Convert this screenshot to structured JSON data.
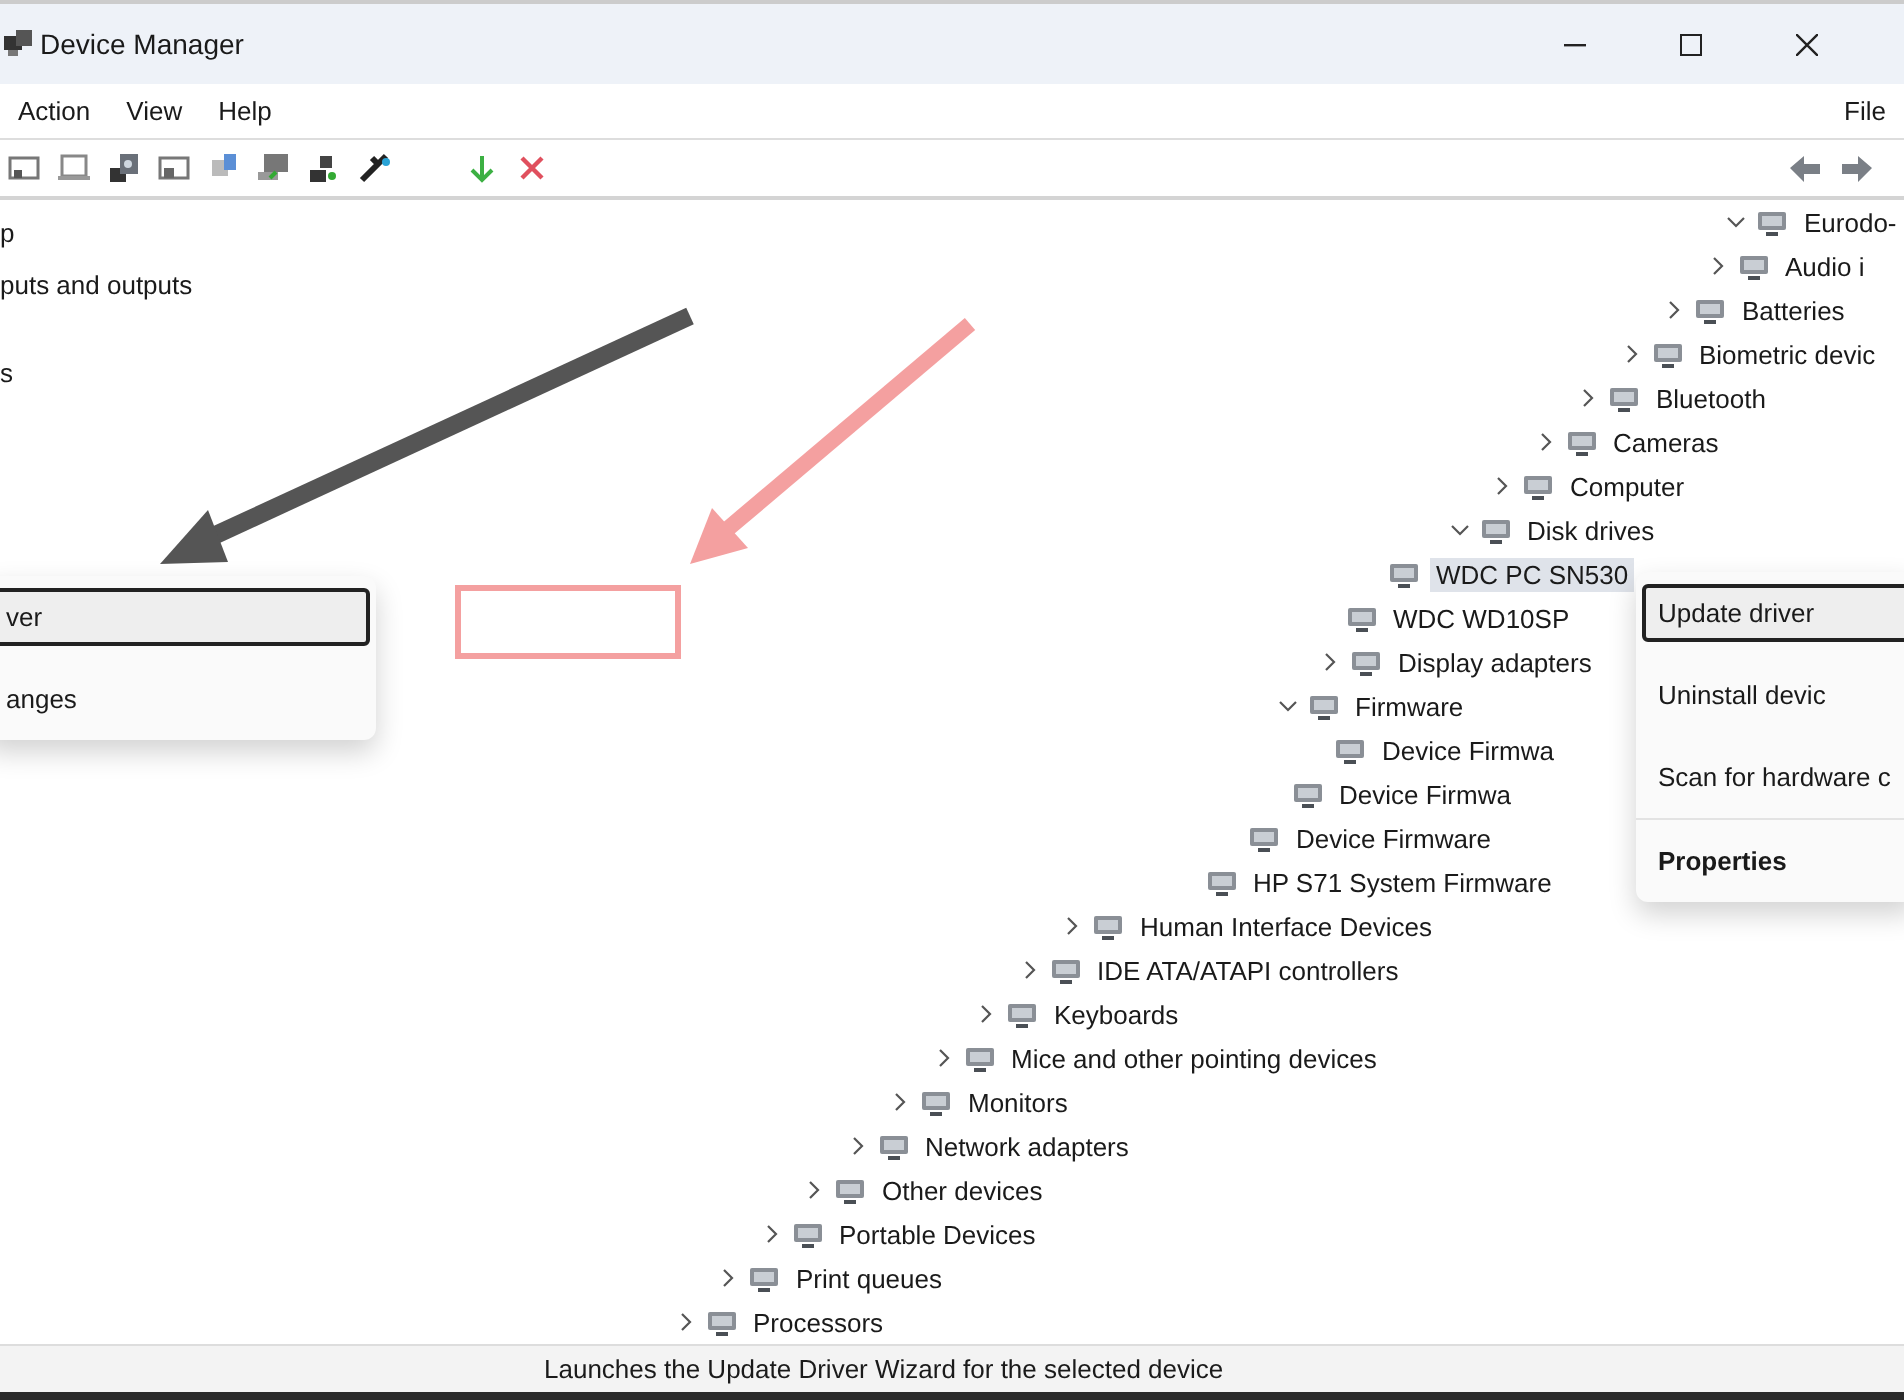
{
  "window": {
    "title": "Device Manager"
  },
  "menu": [
    {
      "label": "Action"
    },
    {
      "label": "View"
    },
    {
      "label": "Help"
    },
    {
      "label": "File"
    }
  ],
  "left_pane": {
    "items": [
      "p",
      "puts and outputs",
      "s"
    ]
  },
  "left_menu": {
    "items": [
      {
        "label": "ver",
        "selected": true
      },
      {
        "label": "anges",
        "selected": false
      }
    ]
  },
  "tree": [
    {
      "label": "Eurodo-",
      "expanded": true,
      "selected": false,
      "children": [
        {
          "label": "Audio i",
          "expanded": false,
          "selected": false
        },
        {
          "label": "Batteries",
          "expanded": false,
          "selected": false
        },
        {
          "label": "Biometric devic",
          "expanded": false,
          "selected": false
        },
        {
          "label": "Bluetooth",
          "expanded": false,
          "selected": false
        },
        {
          "label": "Cameras",
          "expanded": false,
          "selected": false
        },
        {
          "label": "Computer",
          "expanded": false,
          "selected": false
        },
        {
          "label": "Disk drives",
          "expanded": true,
          "selected": false,
          "children": [
            {
              "label": "WDC PC SN530",
              "selected": true
            },
            {
              "label": "WDC WD10SP",
              "selected": false
            }
          ]
        },
        {
          "label": "Display adapters",
          "expanded": false,
          "selected": false
        },
        {
          "label": "Firmware",
          "expanded": true,
          "selected": false,
          "children": [
            {
              "label": "Device Firmwa",
              "selected": false
            },
            {
              "label": "Device Firmwa",
              "selected": false
            },
            {
              "label": "Device Firmware",
              "selected": false
            },
            {
              "label": "HP S71 System Firmware",
              "selected": false
            }
          ]
        },
        {
          "label": "Human Interface Devices",
          "expanded": false,
          "selected": false
        },
        {
          "label": "IDE ATA/ATAPI controllers",
          "expanded": false,
          "selected": false
        },
        {
          "label": "Keyboards",
          "expanded": false,
          "selected": false
        },
        {
          "label": "Mice and other pointing devices",
          "expanded": false,
          "selected": false
        },
        {
          "label": "Monitors",
          "expanded": false,
          "selected": false
        },
        {
          "label": "Network adapters",
          "expanded": false,
          "selected": false
        },
        {
          "label": "Other devices",
          "expanded": false,
          "selected": false
        },
        {
          "label": "Portable Devices",
          "expanded": false,
          "selected": false
        },
        {
          "label": "Print queues",
          "expanded": false,
          "selected": false
        },
        {
          "label": "Processors",
          "expanded": false,
          "selected": false
        }
      ]
    }
  ],
  "context_menu": {
    "items": [
      {
        "label": "Update driver",
        "selected": true,
        "bold": false
      },
      {
        "label": "Uninstall devic",
        "selected": false,
        "bold": false
      },
      {
        "label": "Scan for hardware c",
        "selected": false,
        "bold": false
      },
      {
        "label": "Properties",
        "selected": false,
        "bold": true
      }
    ]
  },
  "status_bar": {
    "text": "Launches the Update Driver Wizard for the selected device"
  }
}
